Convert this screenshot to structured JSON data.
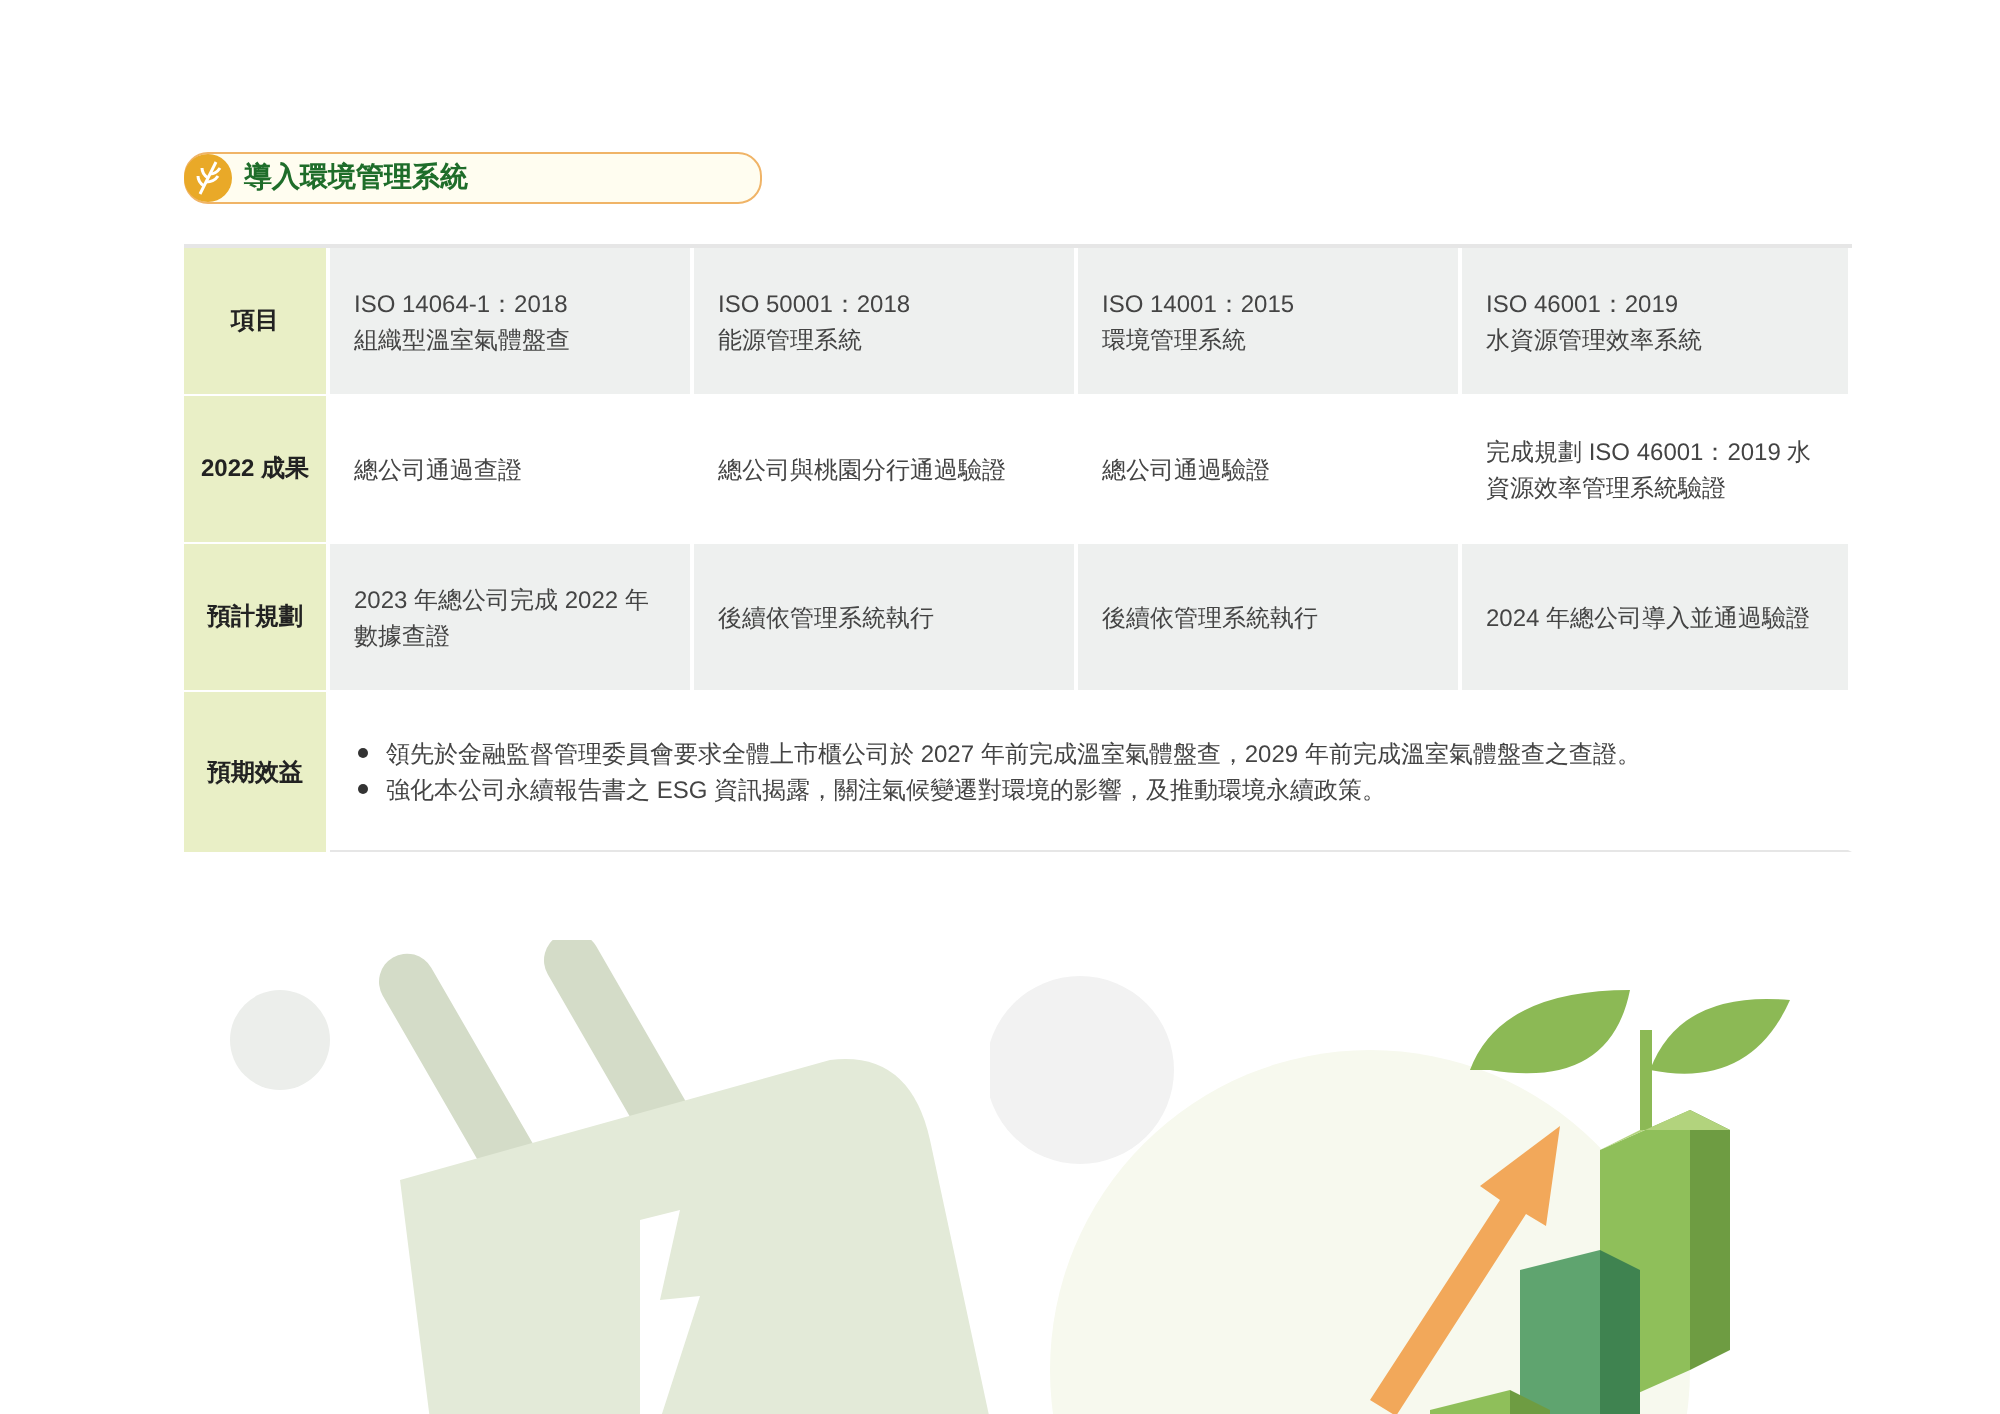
{
  "heading": {
    "title": "導入環境管理系統"
  },
  "table": {
    "header": {
      "label": "項目",
      "cells": [
        {
          "lines": [
            "ISO 14064-1：2018",
            "組織型溫室氣體盤查"
          ]
        },
        {
          "lines": [
            "ISO 50001：2018",
            "能源管理系統"
          ]
        },
        {
          "lines": [
            "ISO 14001：2015",
            "環境管理系統"
          ]
        },
        {
          "lines": [
            "ISO 46001：2019",
            "水資源管理效率系統"
          ]
        }
      ]
    },
    "rows": [
      {
        "label": "2022 成果",
        "cells": [
          "總公司通過查證",
          "總公司與桃園分行通過驗證",
          "總公司通過驗證",
          "完成規劃 ISO 46001：2019 水資源效率管理系統驗證"
        ]
      },
      {
        "label": "預計規劃",
        "cells": [
          "2023 年總公司完成 2022 年數據查證",
          "後續依管理系統執行",
          "後續依管理系統執行",
          "2024 年總公司導入並通過驗證"
        ]
      }
    ],
    "benefits": {
      "label": "預期效益",
      "bullets": [
        "領先於金融監督管理委員會要求全體上市櫃公司於 2027 年前完成溫室氣體盤查，2029 年前完成溫室氣體盤查之查證。",
        "強化本公司永續報告書之 ESG 資訊揭露，關注氣候變遷對環境的影響，及推動環境永續政策。"
      ]
    }
  }
}
